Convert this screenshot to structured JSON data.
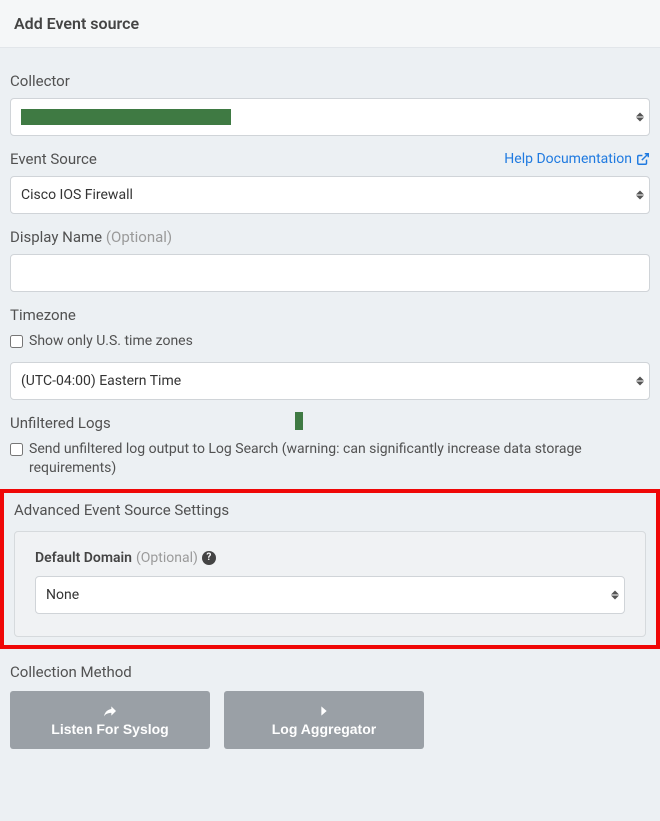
{
  "header": {
    "title": "Add Event source"
  },
  "collector": {
    "label": "Collector",
    "value": ""
  },
  "eventSource": {
    "label": "Event Source",
    "helpText": "Help Documentation",
    "value": "Cisco IOS Firewall"
  },
  "displayName": {
    "label": "Display Name ",
    "optional": "(Optional)",
    "value": ""
  },
  "timezone": {
    "label": "Timezone",
    "usOnlyLabel": "Show only U.S. time zones",
    "value": "(UTC-04:00) Eastern Time"
  },
  "unfiltered": {
    "label": "Unfiltered Logs",
    "checkboxLabel": "Send unfiltered log output to Log Search (warning: can significantly increase data storage requirements)"
  },
  "advanced": {
    "title": "Advanced Event Source Settings",
    "defaultDomain": {
      "label": "Default Domain ",
      "optional": "(Optional)",
      "value": "None"
    }
  },
  "collection": {
    "label": "Collection Method",
    "listen": "Listen For Syslog",
    "aggregator": "Log Aggregator"
  }
}
